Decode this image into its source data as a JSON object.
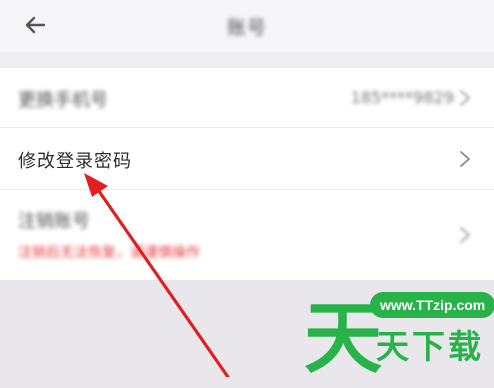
{
  "header": {
    "back_icon": "arrow-left-icon",
    "title": "账号"
  },
  "rows": [
    {
      "label": "更换手机号",
      "value": "185****9829",
      "chevron": "chevron-right-icon"
    },
    {
      "label": "修改登录密码",
      "chevron": "chevron-right-icon"
    },
    {
      "label": "注销账号",
      "warning": "注销后无法恢复，请谨慎操作",
      "chevron": "chevron-right-icon"
    }
  ],
  "annotation": {
    "type": "red-arrow",
    "color": "#e02020",
    "target": "修改登录密码"
  },
  "watermark": {
    "big_char": "天",
    "url": "www.TTzip.com",
    "text": "天下载",
    "color": "#28b34a"
  }
}
